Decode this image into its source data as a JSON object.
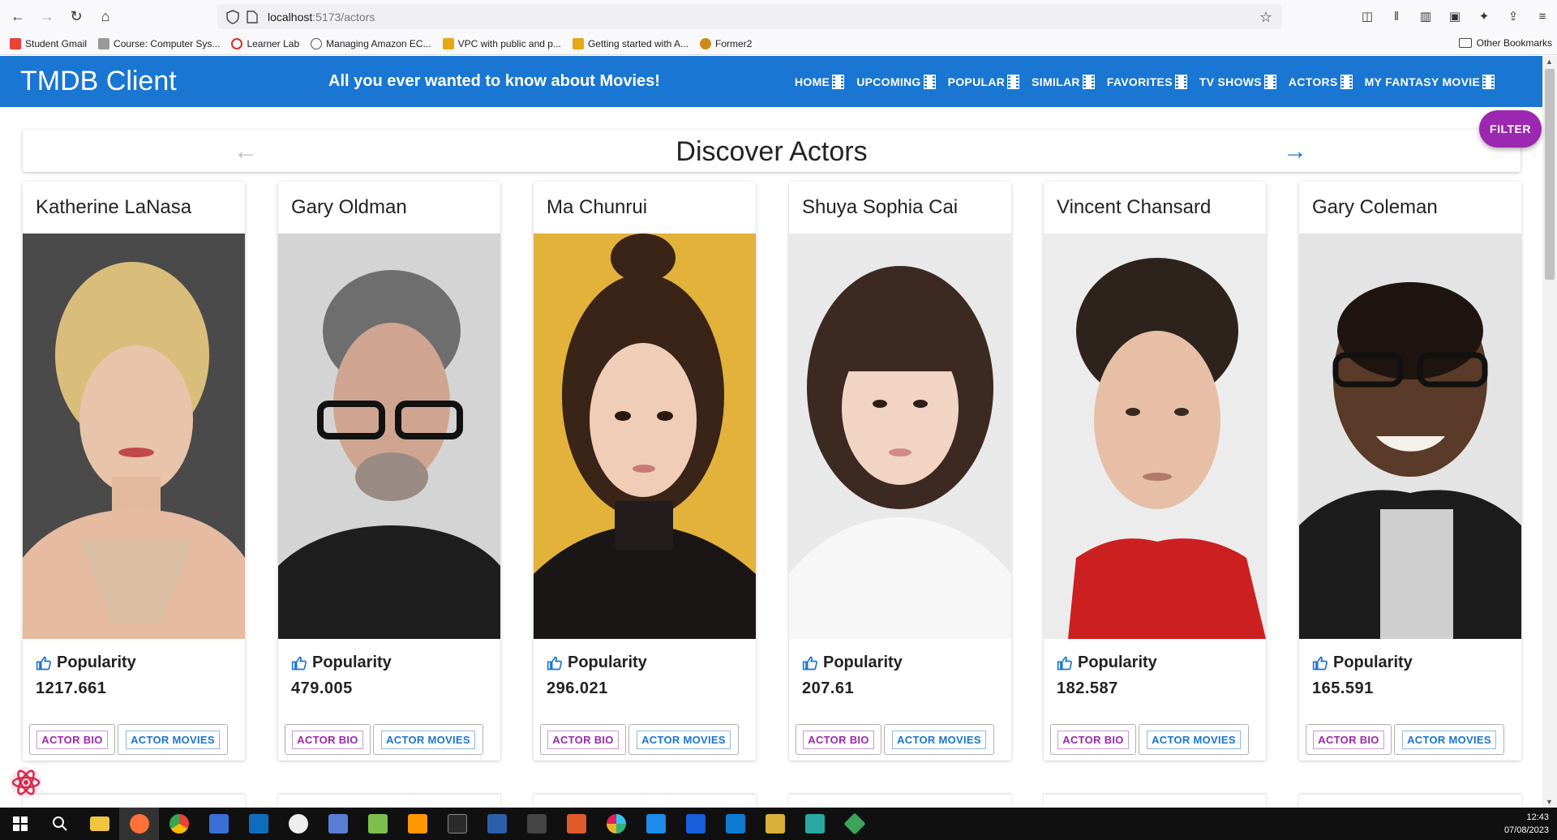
{
  "browser": {
    "url_host": "localhost",
    "url_path": ":5173/actors",
    "bookmarks": [
      {
        "label": "Student Gmail",
        "color": "#ea4335"
      },
      {
        "label": "Course: Computer Sys...",
        "color": "#888888"
      },
      {
        "label": "Learner Lab",
        "color": "#d93025"
      },
      {
        "label": "Managing Amazon EC...",
        "color": "#555555"
      },
      {
        "label": "VPC with public and p...",
        "color": "#e6a817"
      },
      {
        "label": "Getting started with A...",
        "color": "#e6a817"
      },
      {
        "label": "Former2",
        "color": "#cc8a1a"
      }
    ],
    "other_bookmarks": "Other Bookmarks"
  },
  "header": {
    "title": "TMDB Client",
    "tagline": "All you ever wanted to know about Movies!",
    "nav": [
      "HOME",
      "UPCOMING",
      "POPULAR",
      "SIMILAR",
      "FAVORITES",
      "TV SHOWS",
      "ACTORS",
      "MY FANTASY MOVIE"
    ]
  },
  "filter_label": "FILTER",
  "discover": {
    "title": "Discover Actors"
  },
  "popularity_label": "Popularity",
  "buttons": {
    "bio": "ACTOR BIO",
    "movies": "ACTOR MOVIES"
  },
  "actors": [
    {
      "name": "Katherine LaNasa",
      "popularity": "1217.661"
    },
    {
      "name": "Gary Oldman",
      "popularity": "479.005"
    },
    {
      "name": "Ma Chunrui",
      "popularity": "296.021"
    },
    {
      "name": "Shuya Sophia Cai",
      "popularity": "207.61"
    },
    {
      "name": "Vincent Chansard",
      "popularity": "182.587"
    },
    {
      "name": "Gary Coleman",
      "popularity": "165.591"
    }
  ],
  "taskbar": {
    "time": "12:43",
    "date": "07/08/2023"
  },
  "colors": {
    "primary": "#1976d2",
    "secondary": "#9c27b0"
  }
}
